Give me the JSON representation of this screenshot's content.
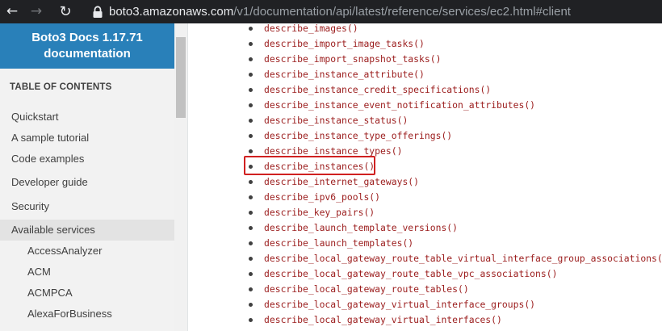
{
  "browser": {
    "url_host": "boto3.amazonaws.com",
    "url_path": "/v1/documentation/api/latest/reference/services/ec2.html#client",
    "back_icon": "←",
    "forward_icon": "→",
    "refresh_icon": "↻"
  },
  "sidebar": {
    "brand_line1": "Boto3 Docs 1.17.71",
    "brand_line2": "documentation",
    "toc_title": "TABLE OF CONTENTS",
    "items": [
      {
        "label": "Quickstart"
      },
      {
        "label": "A sample tutorial"
      },
      {
        "label": "Code examples"
      },
      {
        "label": "Developer guide"
      },
      {
        "label": "Security"
      },
      {
        "label": "Available services"
      }
    ],
    "subitems": [
      {
        "label": "AccessAnalyzer"
      },
      {
        "label": "ACM"
      },
      {
        "label": "ACMPCA"
      },
      {
        "label": "AlexaForBusiness"
      }
    ]
  },
  "methods": [
    "describe_images()",
    "describe_import_image_tasks()",
    "describe_import_snapshot_tasks()",
    "describe_instance_attribute()",
    "describe_instance_credit_specifications()",
    "describe_instance_event_notification_attributes()",
    "describe_instance_status()",
    "describe_instance_type_offerings()",
    "describe_instance_types()",
    "describe_instances()",
    "describe_internet_gateways()",
    "describe_ipv6_pools()",
    "describe_key_pairs()",
    "describe_launch_template_versions()",
    "describe_launch_templates()",
    "describe_local_gateway_route_table_virtual_interface_group_associations()",
    "describe_local_gateway_route_table_vpc_associations()",
    "describe_local_gateway_route_tables()",
    "describe_local_gateway_virtual_interface_groups()",
    "describe_local_gateway_virtual_interfaces()"
  ],
  "highlighted_method": "describe_instances()",
  "colors": {
    "brand": "#2980b9",
    "link": "#9b1c1c",
    "highlight": "#d02020"
  }
}
